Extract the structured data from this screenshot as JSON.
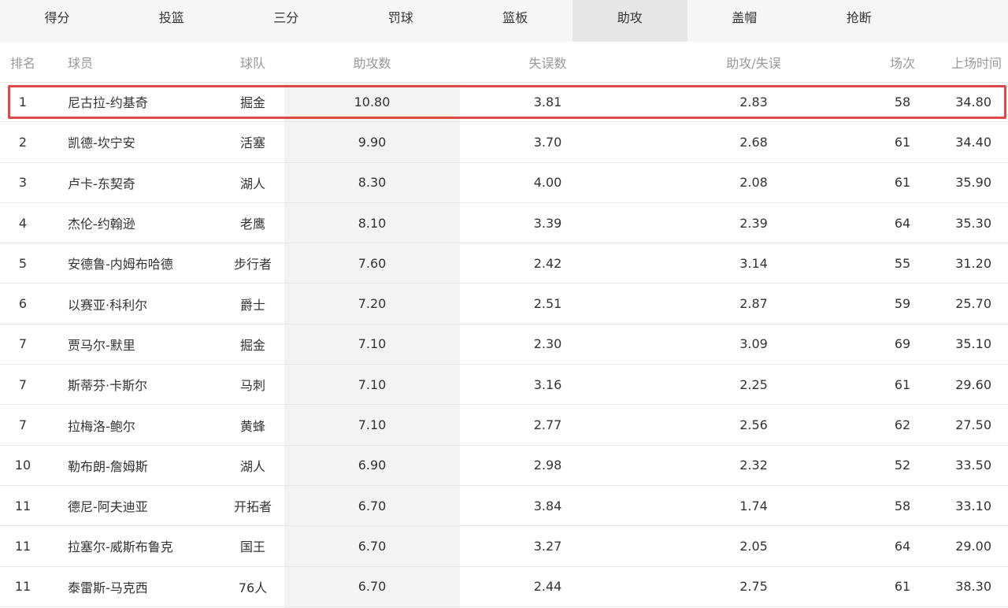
{
  "tabs": [
    {
      "label": "得分",
      "active": false
    },
    {
      "label": "投篮",
      "active": false
    },
    {
      "label": "三分",
      "active": false
    },
    {
      "label": "罚球",
      "active": false
    },
    {
      "label": "篮板",
      "active": false
    },
    {
      "label": "助攻",
      "active": true
    },
    {
      "label": "盖帽",
      "active": false
    },
    {
      "label": "抢断",
      "active": false
    }
  ],
  "columns": {
    "rank": "排名",
    "player": "球员",
    "team": "球队",
    "assists": "助攻数",
    "turnovers": "失误数",
    "ratio": "助攻/失误",
    "games": "场次",
    "minutes": "上场时间"
  },
  "rows": [
    {
      "rank": "1",
      "player": "尼古拉-约基奇",
      "team": "掘金",
      "assists": "10.80",
      "turnovers": "3.81",
      "ratio": "2.83",
      "games": "58",
      "minutes": "34.80"
    },
    {
      "rank": "2",
      "player": "凯德-坎宁安",
      "team": "活塞",
      "assists": "9.90",
      "turnovers": "3.70",
      "ratio": "2.68",
      "games": "61",
      "minutes": "34.40"
    },
    {
      "rank": "3",
      "player": "卢卡-东契奇",
      "team": "湖人",
      "assists": "8.30",
      "turnovers": "4.00",
      "ratio": "2.08",
      "games": "61",
      "minutes": "35.90"
    },
    {
      "rank": "4",
      "player": "杰伦-约翰逊",
      "team": "老鹰",
      "assists": "8.10",
      "turnovers": "3.39",
      "ratio": "2.39",
      "games": "64",
      "minutes": "35.30"
    },
    {
      "rank": "5",
      "player": "安德鲁-内姆布哈德",
      "team": "步行者",
      "assists": "7.60",
      "turnovers": "2.42",
      "ratio": "3.14",
      "games": "55",
      "minutes": "31.20"
    },
    {
      "rank": "6",
      "player": "以赛亚·科利尔",
      "team": "爵士",
      "assists": "7.20",
      "turnovers": "2.51",
      "ratio": "2.87",
      "games": "59",
      "minutes": "25.70"
    },
    {
      "rank": "7",
      "player": "贾马尔-默里",
      "team": "掘金",
      "assists": "7.10",
      "turnovers": "2.30",
      "ratio": "3.09",
      "games": "69",
      "minutes": "35.10"
    },
    {
      "rank": "7",
      "player": "斯蒂芬·卡斯尔",
      "team": "马刺",
      "assists": "7.10",
      "turnovers": "3.16",
      "ratio": "2.25",
      "games": "61",
      "minutes": "29.60"
    },
    {
      "rank": "7",
      "player": "拉梅洛-鲍尔",
      "team": "黄蜂",
      "assists": "7.10",
      "turnovers": "2.77",
      "ratio": "2.56",
      "games": "62",
      "minutes": "27.50"
    },
    {
      "rank": "10",
      "player": "勒布朗-詹姆斯",
      "team": "湖人",
      "assists": "6.90",
      "turnovers": "2.98",
      "ratio": "2.32",
      "games": "52",
      "minutes": "33.50"
    },
    {
      "rank": "11",
      "player": "德尼-阿夫迪亚",
      "team": "开拓者",
      "assists": "6.70",
      "turnovers": "3.84",
      "ratio": "1.74",
      "games": "58",
      "minutes": "33.10"
    },
    {
      "rank": "11",
      "player": "拉塞尔-威斯布鲁克",
      "team": "国王",
      "assists": "6.70",
      "turnovers": "3.27",
      "ratio": "2.05",
      "games": "64",
      "minutes": "29.00"
    },
    {
      "rank": "11",
      "player": "泰雷斯-马克西",
      "team": "76人",
      "assists": "6.70",
      "turnovers": "2.44",
      "ratio": "2.75",
      "games": "61",
      "minutes": "38.30"
    }
  ],
  "highlight_color": "#e04848",
  "active_tab_color": "#e6e6e6"
}
